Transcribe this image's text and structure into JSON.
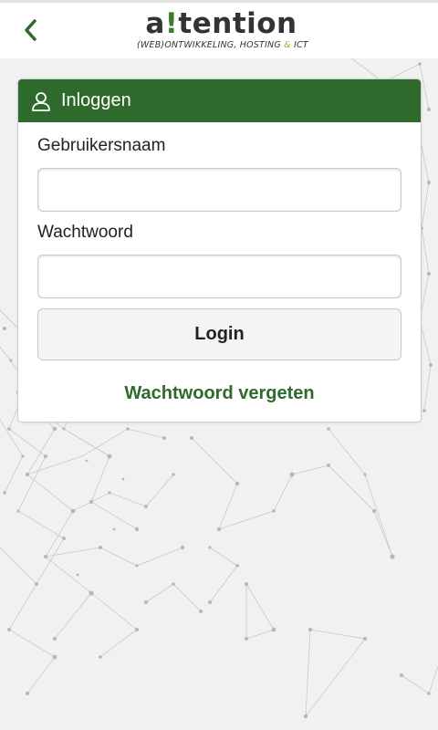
{
  "header": {
    "logo_word_left": "a",
    "logo_word_bang": "!",
    "logo_word_right": "tention",
    "logo_tagline_left": "(WEB)ONTWIKKELING, HOSTING ",
    "logo_tagline_amp": "&",
    "logo_tagline_right": " ICT",
    "back_icon": "chevron-left-icon"
  },
  "login": {
    "header_icon": "user-icon",
    "title": "Inloggen",
    "username_label": "Gebruikersnaam",
    "username_value": "",
    "password_label": "Wachtwoord",
    "password_value": "",
    "login_button": "Login",
    "forgot_link": "Wachtwoord vergeten"
  },
  "colors": {
    "brand_green": "#2e6a2c",
    "accent_lime": "#8ab82a",
    "background": "#f1f1f1"
  }
}
